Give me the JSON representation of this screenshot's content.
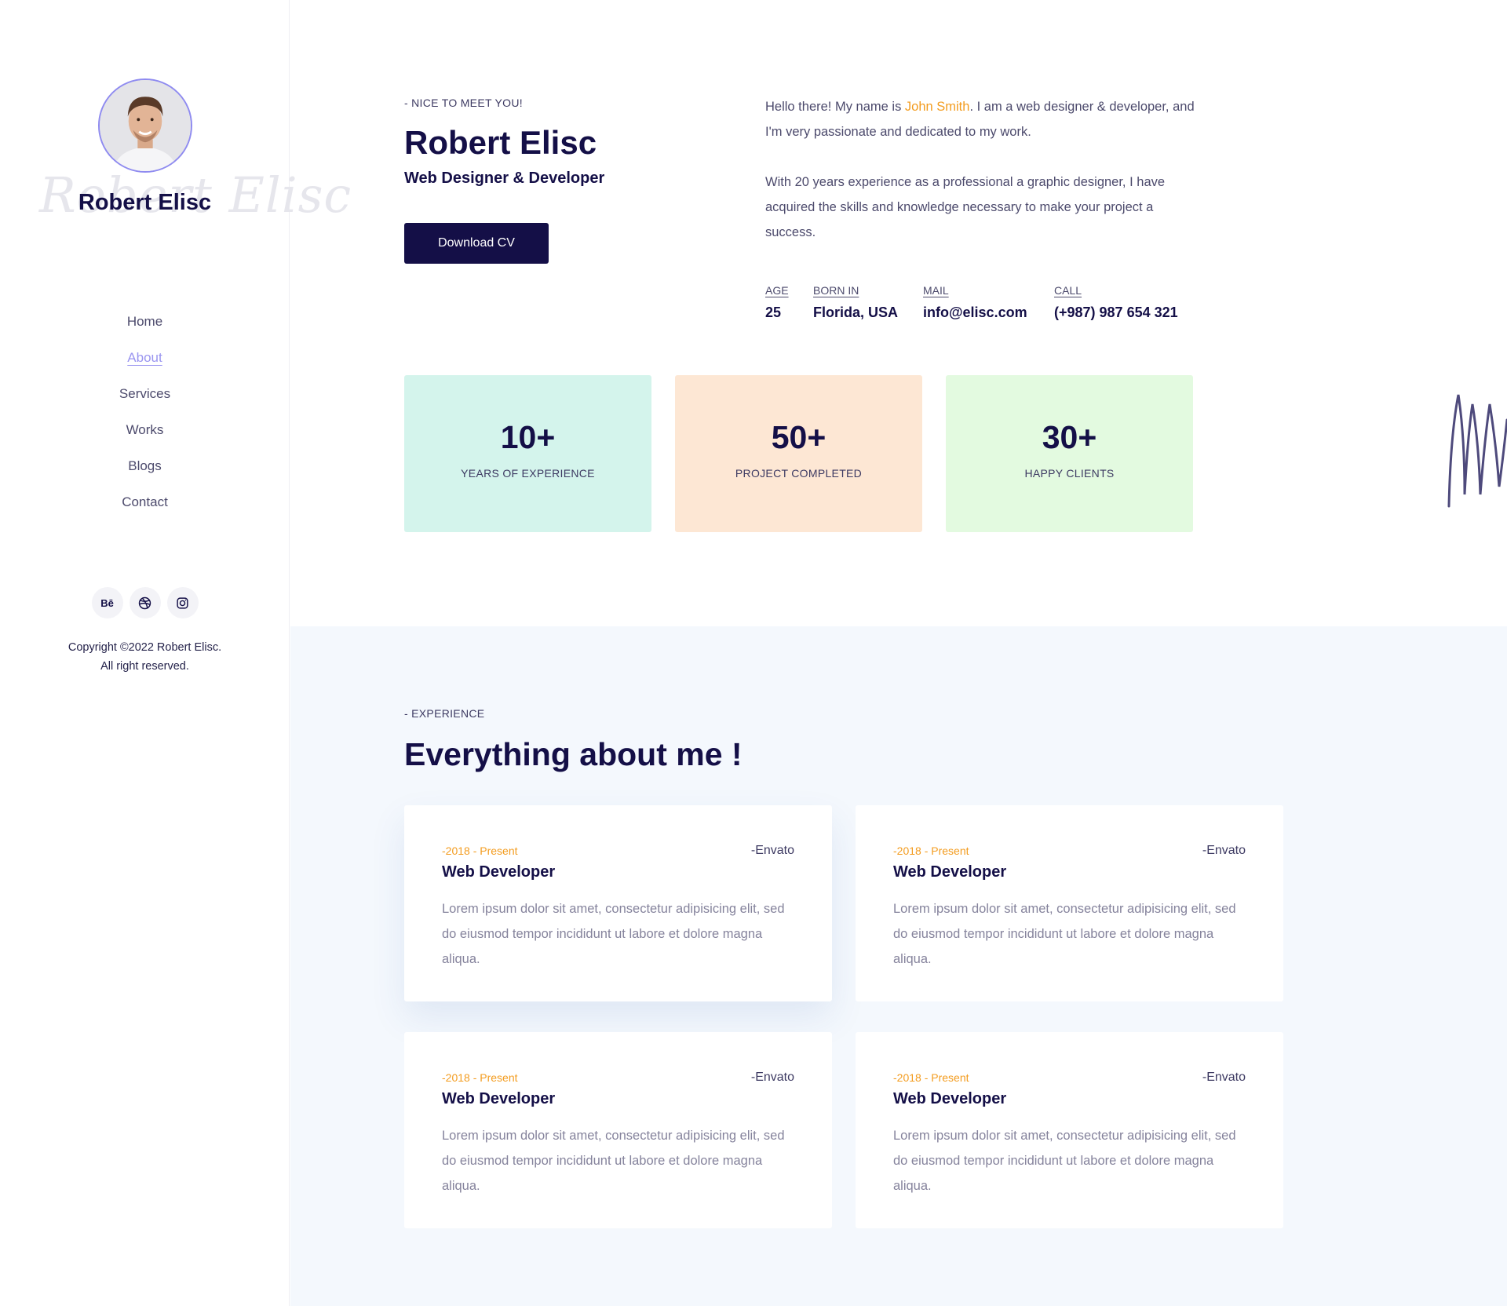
{
  "sidebar": {
    "signature": "Robert Elisc",
    "name": "Robert Elisc",
    "nav": [
      {
        "label": "Home",
        "active": false
      },
      {
        "label": "About",
        "active": true
      },
      {
        "label": "Services",
        "active": false
      },
      {
        "label": "Works",
        "active": false
      },
      {
        "label": "Blogs",
        "active": false
      },
      {
        "label": "Contact",
        "active": false
      }
    ],
    "socials": [
      {
        "icon": "behance-icon",
        "glyph": "Bē"
      },
      {
        "icon": "dribbble-icon",
        "glyph": ""
      },
      {
        "icon": "instagram-icon",
        "glyph": ""
      }
    ],
    "copyright_line1": "Copyright ©2022 Robert Elisc.",
    "copyright_line2": "All right reserved."
  },
  "hero": {
    "kicker": "- NICE TO MEET YOU!",
    "name": "Robert Elisc",
    "role": "Web Designer & Developer",
    "cv_button": "Download CV",
    "intro_part1": "Hello there! My name is ",
    "intro_highlight": "John Smith",
    "intro_part2": ". I am a web designer & developer, and I'm very passionate and dedicated to my work.",
    "intro_paragraph2": "With 20 years experience as a professional a graphic designer, I have acquired the skills and knowledge necessary to make your project a success.",
    "highlight_color": "#f39c1f",
    "info": [
      {
        "label": "AGE",
        "value": "25"
      },
      {
        "label": "BORN IN",
        "value": "Florida, USA"
      },
      {
        "label": "MAIL",
        "value": "info@elisc.com"
      },
      {
        "label": "CALL",
        "value": "(+987) 987 654 321"
      }
    ]
  },
  "stats": [
    {
      "number": "10+",
      "caption": "YEARS OF EXPERIENCE",
      "color": "#d4f4ec"
    },
    {
      "number": "50+",
      "caption": "PROJECT COMPLETED",
      "color": "#fde7d4"
    },
    {
      "number": "30+",
      "caption": "HAPPY CLIENTS",
      "color": "#e3fae0"
    }
  ],
  "experience": {
    "kicker": "- EXPERIENCE",
    "title": "Everything about me !",
    "cards": [
      {
        "date": "-2018 - Present",
        "company": "-Envato",
        "title": "Web Developer",
        "description": "Lorem ipsum dolor sit amet, consectetur adipisicing elit, sed do eiusmod tempor incididunt ut labore et dolore magna aliqua."
      },
      {
        "date": "-2018 - Present",
        "company": "-Envato",
        "title": "Web Developer",
        "description": "Lorem ipsum dolor sit amet, consectetur adipisicing elit, sed do eiusmod tempor incididunt ut labore et dolore magna aliqua."
      },
      {
        "date": "-2018 - Present",
        "company": "-Envato",
        "title": "Web Developer",
        "description": "Lorem ipsum dolor sit amet, consectetur adipisicing elit, sed do eiusmod tempor incididunt ut labore et dolore magna aliqua."
      },
      {
        "date": "-2018 - Present",
        "company": "-Envato",
        "title": "Web Developer",
        "description": "Lorem ipsum dolor sit amet, consectetur adipisicing elit, sed do eiusmod tempor incididunt ut labore et dolore magna aliqua."
      }
    ]
  },
  "colors": {
    "primary": "#140f47",
    "accent": "#f39c1f",
    "nav_active": "#9a95f0",
    "section_bg": "#f4f8fd"
  }
}
